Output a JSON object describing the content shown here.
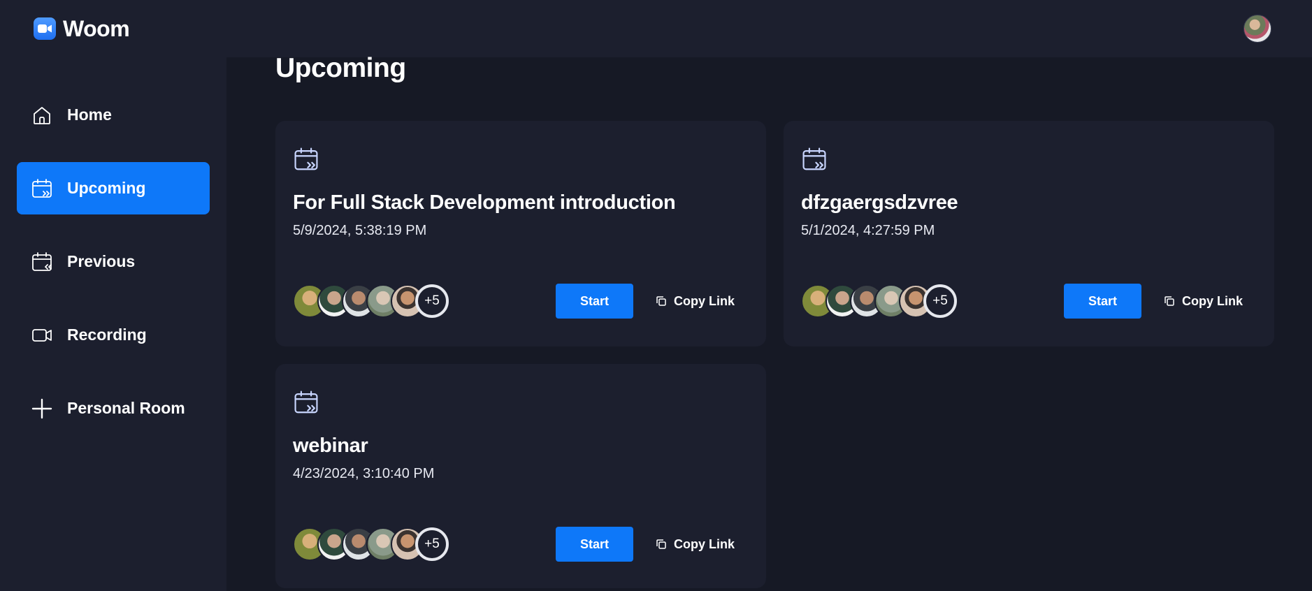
{
  "app": {
    "name": "Woom"
  },
  "sidebar": {
    "items": [
      {
        "label": "Home",
        "icon": "home-icon",
        "active": false
      },
      {
        "label": "Upcoming",
        "icon": "calendar-next-icon",
        "active": true
      },
      {
        "label": "Previous",
        "icon": "calendar-previous-icon",
        "active": false
      },
      {
        "label": "Recording",
        "icon": "video-icon",
        "active": false
      },
      {
        "label": "Personal Room",
        "icon": "plus-icon",
        "active": false
      }
    ]
  },
  "main": {
    "title": "Upcoming",
    "meetings": [
      {
        "title": "For Full Stack Development introduction",
        "date": "5/9/2024, 5:38:19 PM",
        "more_count": "+5",
        "start_label": "Start",
        "copy_label": "Copy Link"
      },
      {
        "title": "dfzgaergsdzvree",
        "date": "5/1/2024, 4:27:59 PM",
        "more_count": "+5",
        "start_label": "Start",
        "copy_label": "Copy Link"
      },
      {
        "title": "webinar",
        "date": "4/23/2024, 3:10:40 PM",
        "more_count": "+5",
        "start_label": "Start",
        "copy_label": "Copy Link"
      }
    ]
  },
  "colors": {
    "accent": "#0e78f9",
    "background": "#161925",
    "panel": "#1c1f2e"
  }
}
